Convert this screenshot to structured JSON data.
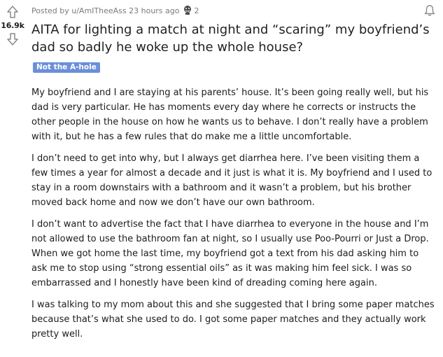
{
  "votes": {
    "count": "16.9k"
  },
  "meta": {
    "posted_by": "Posted by u/AmITheeAss 23 hours ago",
    "award_count": "2"
  },
  "icons": {
    "upvote": "upvote-arrow-icon",
    "downvote": "downvote-arrow-icon",
    "award": "award-icon",
    "bell": "bell-icon"
  },
  "post": {
    "title": "AITA for lighting a match at night and “scaring” my boyfriend’s dad so badly he woke up the whole house?",
    "flair": "Not the A-hole",
    "paragraphs": [
      "My boyfriend and I are staying at his parents’ house. It’s been going really well, but his dad is very particular. He has moments every day where he corrects or instructs the other people in the house on how he wants us to behave. I don’t really have a problem with it, but he has a few rules that do make me a little uncomfortable.",
      "I don’t need to get into why, but I always get diarrhea here. I’ve been visiting them a few times a year for almost a decade and it just is what it is. My boyfriend and I used to stay in a room downstairs with a bathroom and it wasn’t a problem, but his brother moved back home and now we don’t have our own bathroom.",
      "I don’t want to advertise the fact that I have diarrhea to everyone in the house and I’m not allowed to use the bathroom fan at night, so I usually use Poo-Pourri or Just a Drop. When we got home the last time, my boyfriend got a text from his dad asking him to ask me to stop using “strong essential oils” as it was making him feel sick. I was so embarrassed and I honestly have been kind of dreading coming here again.",
      "I was talking to my mom about this and she suggested that I bring some paper matches because that’s what she used to do. I got some paper matches and they actually work pretty well."
    ]
  },
  "colors": {
    "flair_bg": "#6b8fd8",
    "meta_text": "#787c7e",
    "body_text": "#1c1c1c"
  }
}
